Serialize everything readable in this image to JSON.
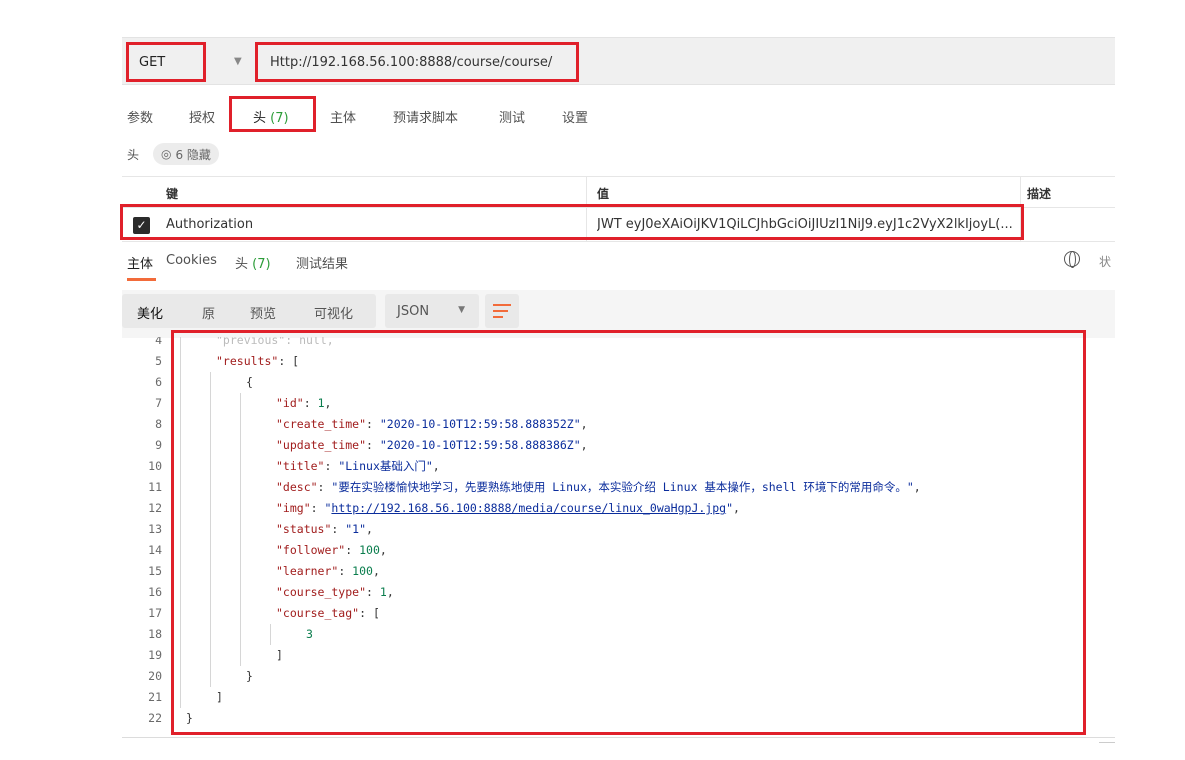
{
  "request": {
    "method": "GET",
    "url": "Http://192.168.56.100:8888/course/course/"
  },
  "request_tabs": [
    {
      "label": "参数"
    },
    {
      "label": "授权"
    },
    {
      "label": "头",
      "count": "(7)"
    },
    {
      "label": "主体"
    },
    {
      "label": "预请求脚本"
    },
    {
      "label": "测试"
    },
    {
      "label": "设置"
    }
  ],
  "headers_section": {
    "label": "头",
    "hidden": "6 隐藏",
    "columns": {
      "key": "键",
      "value": "值",
      "desc": "描述"
    },
    "rows": [
      {
        "checked": true,
        "key": "Authorization",
        "value": "JWT eyJ0eXAiOiJKV1QiLCJhbGciOiJIUzI1NiJ9.eyJ1c2VyX2lkIjoyL(..."
      }
    ]
  },
  "response_tabs": [
    {
      "label": "主体"
    },
    {
      "label": "Cookies"
    },
    {
      "label": "头",
      "count": "(7)"
    },
    {
      "label": "测试结果"
    }
  ],
  "status_cut": "状",
  "body_toolbar": {
    "formats": [
      "美化",
      "原",
      "预览",
      "可视化"
    ],
    "language": "JSON"
  },
  "code_lines": [
    {
      "n": "4",
      "indent": 1,
      "parts": [
        {
          "t": "\"previous\": null,",
          "c": "dim"
        }
      ]
    },
    {
      "n": "5",
      "indent": 1,
      "parts": [
        {
          "t": "\"results\"",
          "c": "k"
        },
        {
          "t": ": [",
          "c": "p"
        }
      ]
    },
    {
      "n": "6",
      "indent": 2,
      "parts": [
        {
          "t": "{",
          "c": "p"
        }
      ]
    },
    {
      "n": "7",
      "indent": 3,
      "parts": [
        {
          "t": "\"id\"",
          "c": "k"
        },
        {
          "t": ": ",
          "c": "p"
        },
        {
          "t": "1",
          "c": "n"
        },
        {
          "t": ",",
          "c": "p"
        }
      ]
    },
    {
      "n": "8",
      "indent": 3,
      "parts": [
        {
          "t": "\"create_time\"",
          "c": "k"
        },
        {
          "t": ": ",
          "c": "p"
        },
        {
          "t": "\"2020-10-10T12:59:58.888352Z\"",
          "c": "s"
        },
        {
          "t": ",",
          "c": "p"
        }
      ]
    },
    {
      "n": "9",
      "indent": 3,
      "parts": [
        {
          "t": "\"update_time\"",
          "c": "k"
        },
        {
          "t": ": ",
          "c": "p"
        },
        {
          "t": "\"2020-10-10T12:59:58.888386Z\"",
          "c": "s"
        },
        {
          "t": ",",
          "c": "p"
        }
      ]
    },
    {
      "n": "10",
      "indent": 3,
      "parts": [
        {
          "t": "\"title\"",
          "c": "k"
        },
        {
          "t": ": ",
          "c": "p"
        },
        {
          "t": "\"Linux基础入门\"",
          "c": "s"
        },
        {
          "t": ",",
          "c": "p"
        }
      ]
    },
    {
      "n": "11",
      "indent": 3,
      "parts": [
        {
          "t": "\"desc\"",
          "c": "k"
        },
        {
          "t": ": ",
          "c": "p"
        },
        {
          "t": "\"要在实验楼愉快地学习，先要熟练地使用 Linux，本实验介绍 Linux 基本操作，shell 环境下的常用命令。\"",
          "c": "s"
        },
        {
          "t": ",",
          "c": "p"
        }
      ]
    },
    {
      "n": "12",
      "indent": 3,
      "parts": [
        {
          "t": "\"img\"",
          "c": "k"
        },
        {
          "t": ": ",
          "c": "p"
        },
        {
          "t": "\"",
          "c": "s"
        },
        {
          "t": "http://192.168.56.100:8888/media/course/linux_0waHgpJ.jpg",
          "c": "lnk"
        },
        {
          "t": "\"",
          "c": "s"
        },
        {
          "t": ",",
          "c": "p"
        }
      ]
    },
    {
      "n": "13",
      "indent": 3,
      "parts": [
        {
          "t": "\"status\"",
          "c": "k"
        },
        {
          "t": ": ",
          "c": "p"
        },
        {
          "t": "\"1\"",
          "c": "s"
        },
        {
          "t": ",",
          "c": "p"
        }
      ]
    },
    {
      "n": "14",
      "indent": 3,
      "parts": [
        {
          "t": "\"follower\"",
          "c": "k"
        },
        {
          "t": ": ",
          "c": "p"
        },
        {
          "t": "100",
          "c": "n"
        },
        {
          "t": ",",
          "c": "p"
        }
      ]
    },
    {
      "n": "15",
      "indent": 3,
      "parts": [
        {
          "t": "\"learner\"",
          "c": "k"
        },
        {
          "t": ": ",
          "c": "p"
        },
        {
          "t": "100",
          "c": "n"
        },
        {
          "t": ",",
          "c": "p"
        }
      ]
    },
    {
      "n": "16",
      "indent": 3,
      "parts": [
        {
          "t": "\"course_type\"",
          "c": "k"
        },
        {
          "t": ": ",
          "c": "p"
        },
        {
          "t": "1",
          "c": "n"
        },
        {
          "t": ",",
          "c": "p"
        }
      ]
    },
    {
      "n": "17",
      "indent": 3,
      "parts": [
        {
          "t": "\"course_tag\"",
          "c": "k"
        },
        {
          "t": ": [",
          "c": "p"
        }
      ]
    },
    {
      "n": "18",
      "indent": 4,
      "parts": [
        {
          "t": "3",
          "c": "n"
        }
      ]
    },
    {
      "n": "19",
      "indent": 3,
      "parts": [
        {
          "t": "]",
          "c": "p"
        }
      ]
    },
    {
      "n": "20",
      "indent": 2,
      "parts": [
        {
          "t": "}",
          "c": "p"
        }
      ]
    },
    {
      "n": "21",
      "indent": 1,
      "parts": [
        {
          "t": "]",
          "c": "p"
        }
      ]
    },
    {
      "n": "22",
      "indent": 0,
      "parts": [
        {
          "t": "}",
          "c": "p"
        }
      ]
    }
  ],
  "colors": {
    "highlight": "#e0202a",
    "accent": "#f26b3a",
    "count": "#2d9d3a"
  },
  "icons": {
    "visibility": "eye-icon",
    "globe": "globe-icon",
    "wrap": "word-wrap-icon",
    "dropdown": "chevron-down-icon"
  }
}
